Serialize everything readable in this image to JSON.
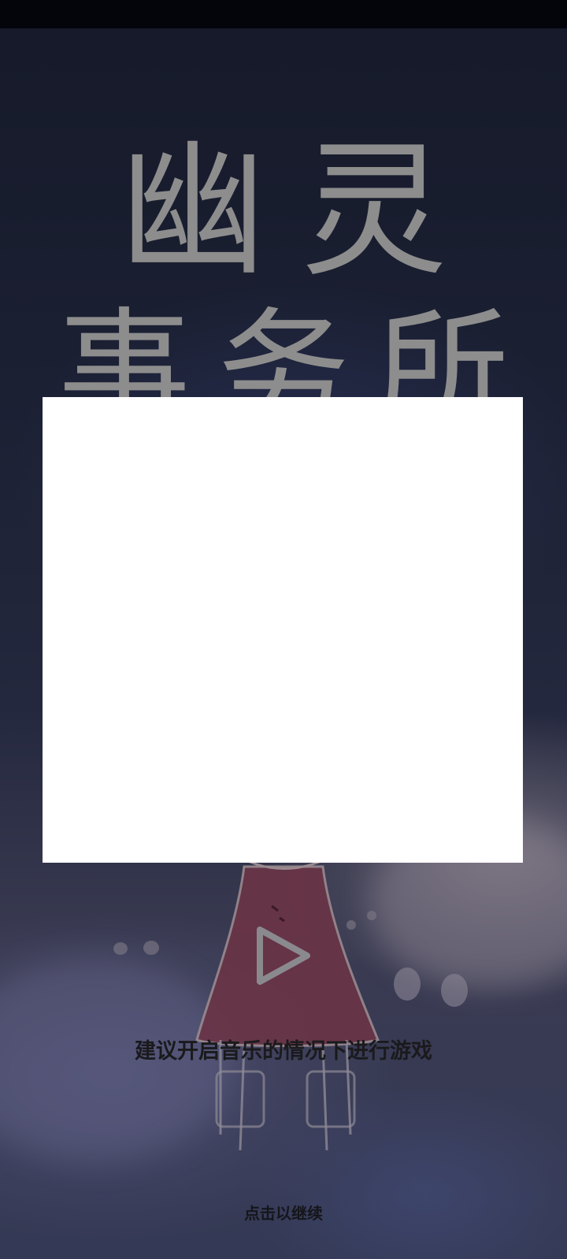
{
  "game": {
    "title_line_1": "幽灵",
    "title_line_2": "事务所",
    "hint": "建议开启音乐的情况下进行游戏",
    "continue": "点击以继续",
    "play_icon": "play-icon"
  },
  "colors": {
    "background_top": "#161a2a",
    "background_bottom": "#343955",
    "title": "#8d8d8d",
    "panel": "#ffffff",
    "character_cloak": "#8a3f55"
  }
}
